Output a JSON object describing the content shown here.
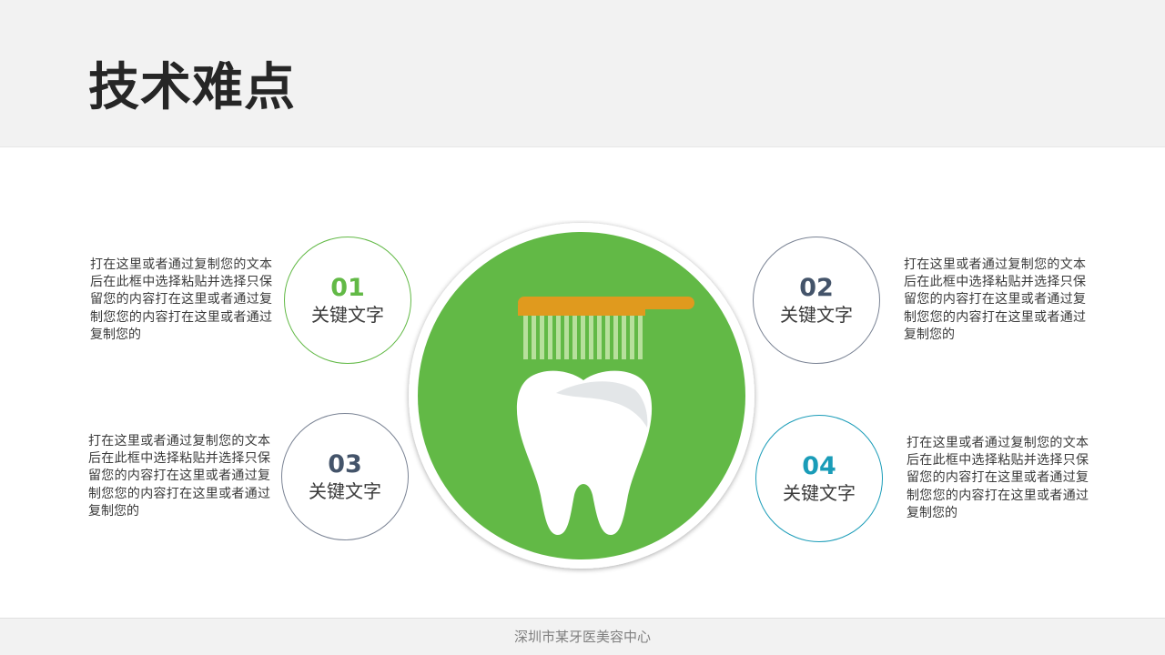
{
  "slide": {
    "title": "技术难点",
    "footer": "深圳市某牙医美容中心"
  },
  "items": [
    {
      "number": "01",
      "label": "关键文字",
      "color": "#62b946",
      "text": "打在这里或者通过复制您的文本后在此框中选择粘贴并选择只保留您的内容打在这里或者通过复制您您的内容打在这里或者通过复制您的"
    },
    {
      "number": "02",
      "label": "关键文字",
      "color": "#44546a",
      "text": "打在这里或者通过复制您的文本后在此框中选择粘贴并选择只保留您的内容打在这里或者通过复制您您的内容打在这里或者通过复制您的"
    },
    {
      "number": "03",
      "label": "关键文字",
      "color": "#44546a",
      "text": "打在这里或者通过复制您的文本后在此框中选择粘贴并选择只保留您的内容打在这里或者通过复制您您的内容打在这里或者通过复制您的"
    },
    {
      "number": "04",
      "label": "关键文字",
      "color": "#1a9cb8",
      "text": "打在这里或者通过复制您的文本后在此框中选择粘贴并选择只保留您的内容打在这里或者通过复制您您的内容打在这里或者通过复制您的"
    }
  ],
  "graphic": {
    "icon": "tooth-and-toothbrush-icon",
    "background_color": "#62b946",
    "brush_color": "#e09a1e"
  }
}
